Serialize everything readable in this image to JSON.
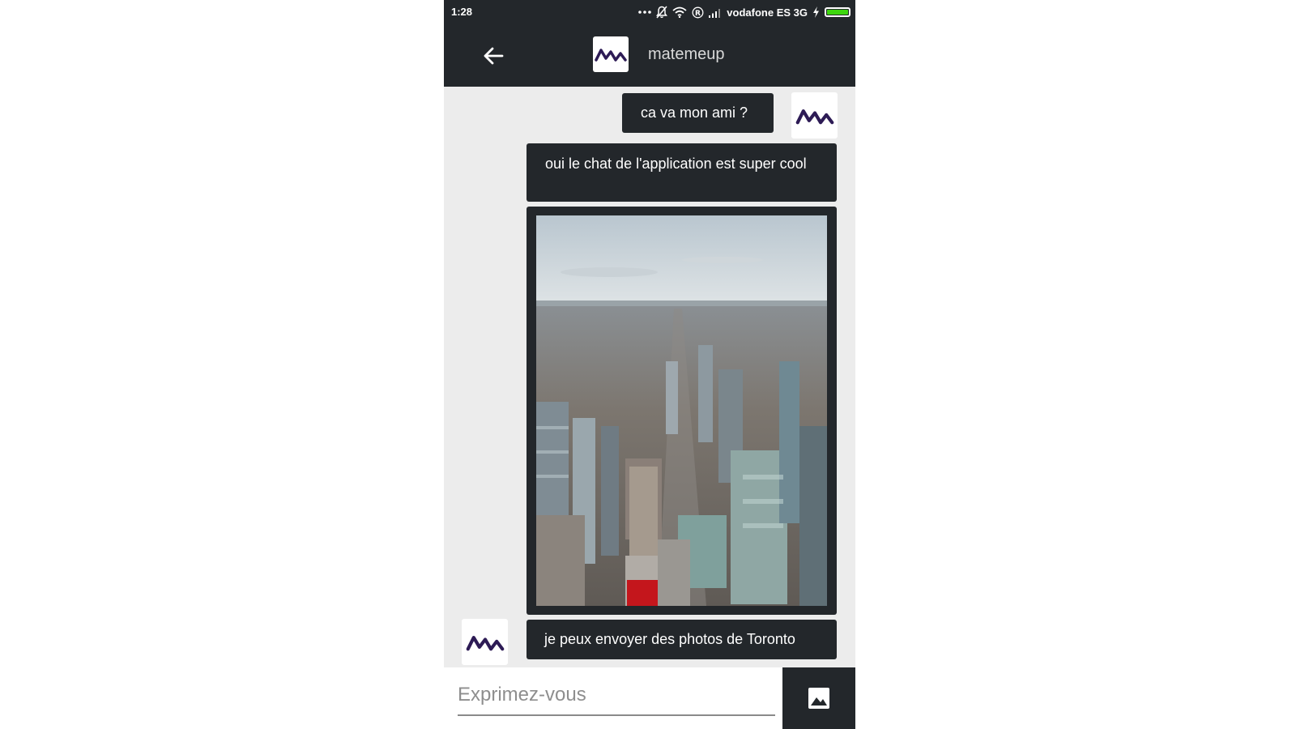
{
  "status_bar": {
    "time": "1:28",
    "carrier": "vodafone ES 3G",
    "battery_level": 1.0,
    "icons": [
      "more-dots-icon",
      "bell-off-icon",
      "wifi-icon",
      "roaming-icon",
      "signal-icon",
      "charging-icon",
      "battery-icon"
    ]
  },
  "header": {
    "back_icon": "arrow-left-icon",
    "avatar_icon": "matemeup-logo",
    "title": "matemeup"
  },
  "messages": [
    {
      "type": "text",
      "side": "right",
      "text": "ca va mon ami ?"
    },
    {
      "type": "text",
      "side": "right",
      "text": "oui le chat de l'application est super cool"
    },
    {
      "type": "image",
      "side": "right"
    },
    {
      "type": "text",
      "side": "left",
      "text": "je peux envoyer des photos de Toronto"
    }
  ],
  "input": {
    "placeholder": "Exprimez-vous",
    "value": "",
    "image_button_icon": "image-icon"
  },
  "colors": {
    "dark": "#23272b",
    "background": "#ececec",
    "logo": "#2d1b55",
    "battery": "#3ed60f"
  }
}
